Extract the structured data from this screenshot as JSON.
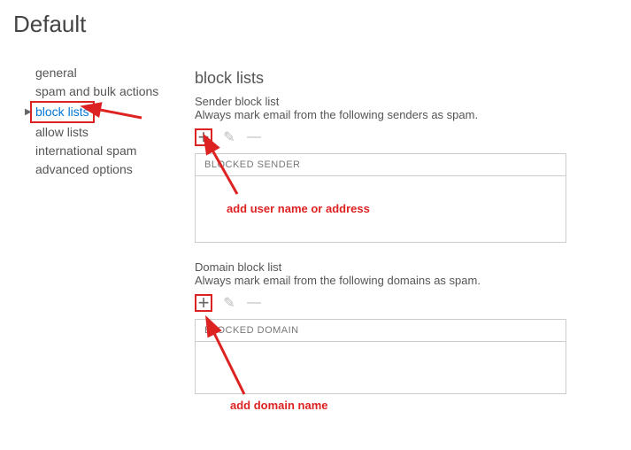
{
  "title": "Default",
  "sidebar": {
    "items": [
      {
        "label": "general"
      },
      {
        "label": "spam and bulk actions"
      },
      {
        "label": "block lists"
      },
      {
        "label": "allow lists"
      },
      {
        "label": "international spam"
      },
      {
        "label": "advanced options"
      }
    ],
    "activeIndex": 2
  },
  "content": {
    "heading": "block lists",
    "senderList": {
      "title": "Sender block list",
      "desc": "Always mark email from the following senders as spam.",
      "columnHeader": "BLOCKED SENDER"
    },
    "domainList": {
      "title": "Domain block list",
      "desc": "Always mark email from the following domains as spam.",
      "columnHeader": "BLOCKED DOMAIN"
    }
  },
  "annotations": {
    "sender": "add user name or address",
    "domain": "add domain name"
  }
}
